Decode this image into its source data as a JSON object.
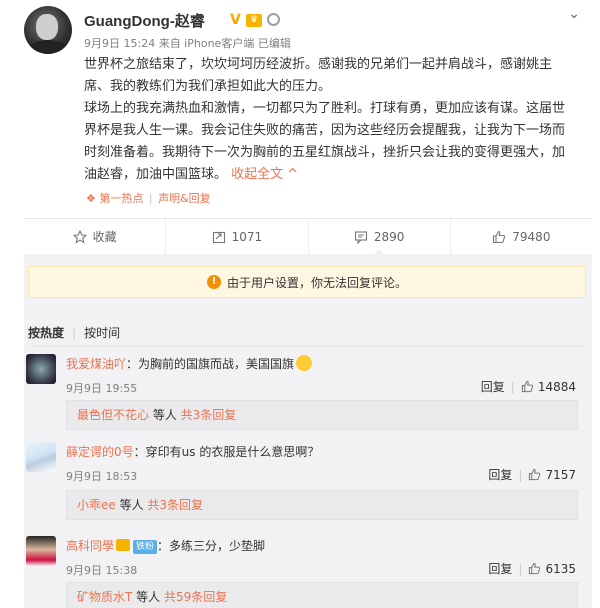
{
  "post": {
    "username": "GuangDong-赵睿",
    "verified_mark": "V",
    "meta": "9月9日 15:24 来自 iPhone客户端  已编辑",
    "paragraph1": "世界杯之旅结束了，坎坎坷坷历经波折。感谢我的兄弟们一起并肩战斗，感谢姚主席、我的教练们为我们承担如此大的压力。",
    "paragraph2": "球场上的我充满热血和激情，一切都只为了胜利。打球有勇，更加应该有谋。这届世界杯是我人生一课。我会记住失败的痛苦，因为这些经历会提醒我，让我为下一场而时刻准备着。我期待下一次为胸前的五星红旗战斗，挫折只会让我的变得更强大，加油赵睿，加油中国篮球。",
    "collapse_label": "收起全文 ^",
    "hot_label": "❖ 第一热点",
    "statement_label": "声明&回复"
  },
  "actions": {
    "favorite": "收藏",
    "repost": "1071",
    "comment": "2890",
    "like": "79480"
  },
  "notice": "由于用户设置，你无法回复评论。",
  "sort": {
    "hot": "按热度",
    "time": "按时间"
  },
  "comments": [
    {
      "user": "我爱煤油吖",
      "text": "：为胸前的国旗而战，美国国旗",
      "time": "9月9日 19:55",
      "reply": "回复",
      "likes": "14884",
      "sub_user": "最色但不花心",
      "sub_middle": " 等人 ",
      "sub_count": "共3条回复"
    },
    {
      "user": "薛定谔的0号",
      "text": "：穿印有us 的衣服是什么意思啊？",
      "time": "9月9日 18:53",
      "reply": "回复",
      "likes": "7157",
      "sub_user": "小乖ee",
      "sub_middle": " 等人 ",
      "sub_count": "共3条回复"
    },
    {
      "user": "高科同學",
      "fan_badge": "铁粉",
      "text": "：多练三分，少垫脚",
      "time": "9月9日 15:38",
      "reply": "回复",
      "likes": "6135",
      "sub_user": "矿物质水T",
      "sub_middle": " 等人 ",
      "sub_count": "共59条回复"
    }
  ],
  "colors": {
    "accent": "#eb7350",
    "gold": "#f5b400",
    "comment_bg": "#f2f2f5",
    "notice_bg": "#fff7e1"
  }
}
